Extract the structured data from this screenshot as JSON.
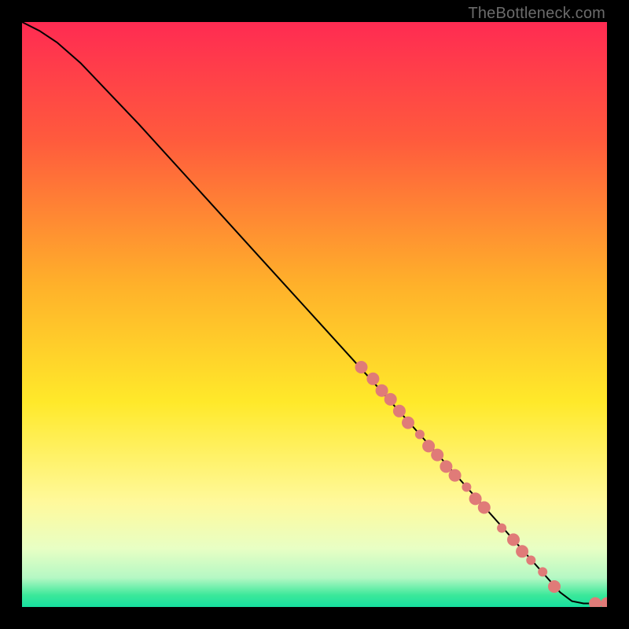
{
  "watermark": "TheBottleneck.com",
  "chart_data": {
    "type": "line",
    "title": "",
    "xlabel": "",
    "ylabel": "",
    "xlim": [
      0,
      100
    ],
    "ylim": [
      0,
      100
    ],
    "background_gradient_stops": [
      {
        "offset": 0,
        "color": "#ff2b52"
      },
      {
        "offset": 20,
        "color": "#ff5a3d"
      },
      {
        "offset": 45,
        "color": "#ffb12a"
      },
      {
        "offset": 65,
        "color": "#ffe92a"
      },
      {
        "offset": 82,
        "color": "#fff99b"
      },
      {
        "offset": 90,
        "color": "#e8ffc4"
      },
      {
        "offset": 95,
        "color": "#b5f8c4"
      },
      {
        "offset": 98,
        "color": "#3be89a"
      },
      {
        "offset": 100,
        "color": "#16e09f"
      }
    ],
    "curve": [
      {
        "x": 0,
        "y": 100
      },
      {
        "x": 3,
        "y": 98.5
      },
      {
        "x": 6,
        "y": 96.5
      },
      {
        "x": 10,
        "y": 93
      },
      {
        "x": 20,
        "y": 82.5
      },
      {
        "x": 30,
        "y": 71.5
      },
      {
        "x": 40,
        "y": 60.5
      },
      {
        "x": 50,
        "y": 49.5
      },
      {
        "x": 60,
        "y": 38.5
      },
      {
        "x": 72,
        "y": 25
      },
      {
        "x": 84,
        "y": 11.5
      },
      {
        "x": 92,
        "y": 2.5
      },
      {
        "x": 94,
        "y": 1.0
      },
      {
        "x": 96,
        "y": 0.6
      },
      {
        "x": 100,
        "y": 0.6
      }
    ],
    "markers": {
      "color": "#e07b78",
      "radius_small": 6,
      "radius_large": 8,
      "points": [
        {
          "x": 58,
          "y": 41,
          "r": "large"
        },
        {
          "x": 60,
          "y": 39,
          "r": "large"
        },
        {
          "x": 61.5,
          "y": 37,
          "r": "large"
        },
        {
          "x": 63,
          "y": 35.5,
          "r": "large"
        },
        {
          "x": 64.5,
          "y": 33.5,
          "r": "large"
        },
        {
          "x": 66,
          "y": 31.5,
          "r": "large"
        },
        {
          "x": 68,
          "y": 29.5,
          "r": "small"
        },
        {
          "x": 69.5,
          "y": 27.5,
          "r": "large"
        },
        {
          "x": 71,
          "y": 26,
          "r": "large"
        },
        {
          "x": 72.5,
          "y": 24,
          "r": "large"
        },
        {
          "x": 74,
          "y": 22.5,
          "r": "large"
        },
        {
          "x": 76,
          "y": 20.5,
          "r": "small"
        },
        {
          "x": 77.5,
          "y": 18.5,
          "r": "large"
        },
        {
          "x": 79,
          "y": 17,
          "r": "large"
        },
        {
          "x": 82,
          "y": 13.5,
          "r": "small"
        },
        {
          "x": 84,
          "y": 11.5,
          "r": "large"
        },
        {
          "x": 85.5,
          "y": 9.5,
          "r": "large"
        },
        {
          "x": 87,
          "y": 8,
          "r": "small"
        },
        {
          "x": 89,
          "y": 6,
          "r": "small"
        },
        {
          "x": 91,
          "y": 3.5,
          "r": "large"
        },
        {
          "x": 98,
          "y": 0.6,
          "r": "large"
        },
        {
          "x": 100,
          "y": 0.6,
          "r": "large"
        }
      ]
    }
  }
}
